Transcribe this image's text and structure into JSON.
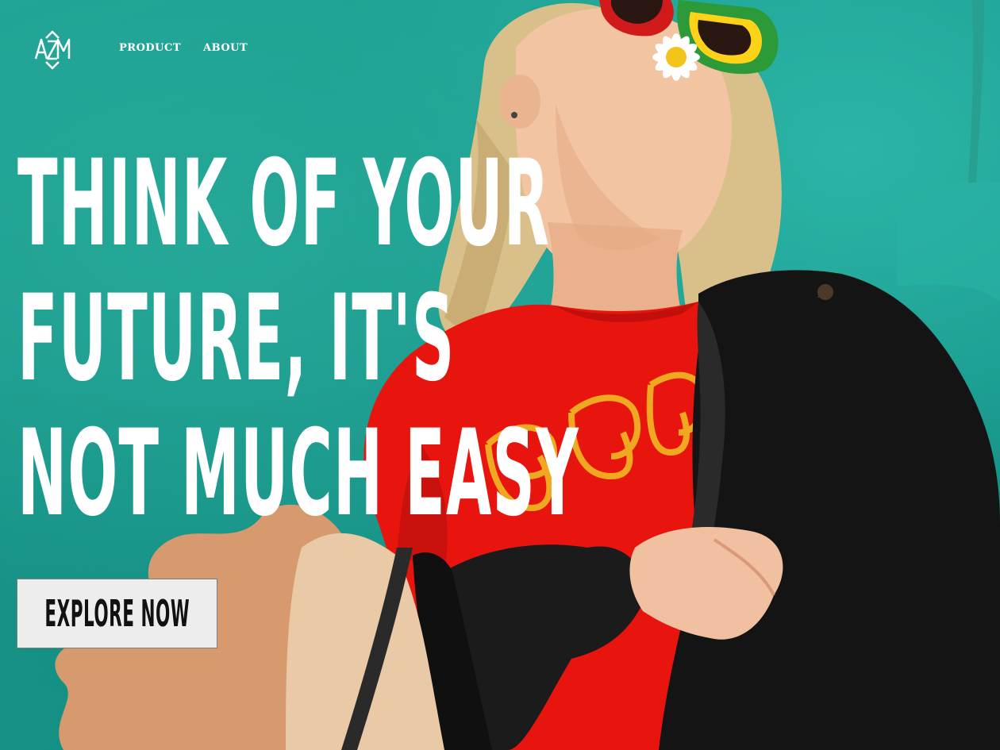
{
  "brand": {
    "logo_text": "A2M"
  },
  "nav": {
    "items": [
      {
        "label": "PRODUCT"
      },
      {
        "label": "ABOUT"
      }
    ]
  },
  "hero": {
    "headline_lines": [
      "THINK OF YOUR",
      "FUTURE, IT'S",
      "NOT MUCH EASY"
    ],
    "cta_label": "EXPLORE NOW"
  },
  "colors": {
    "background_teal": "#1a9a8c",
    "shirt_red": "#e8150f",
    "jacket_black": "#141414",
    "splash_tan": "#d69a6e",
    "button_bg": "#ededee",
    "headline_white": "#ffffff"
  }
}
